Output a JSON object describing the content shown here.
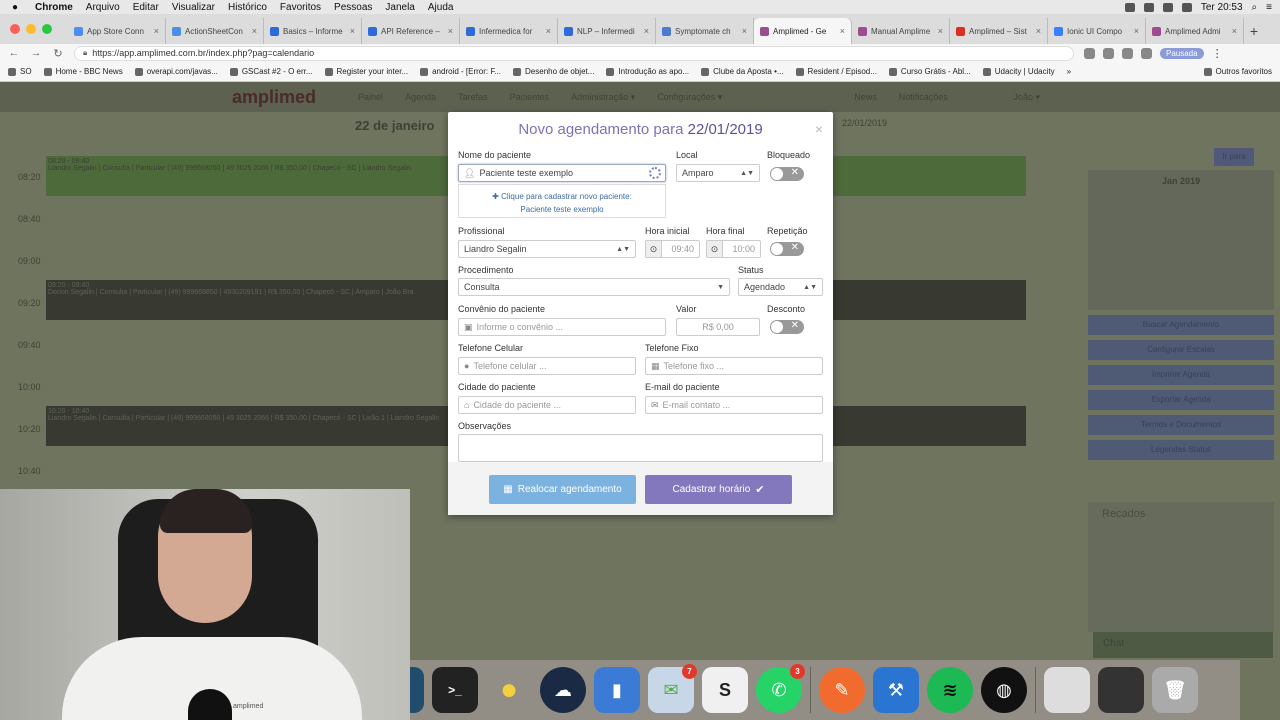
{
  "menubar": {
    "apple": "",
    "items": [
      "Chrome",
      "Arquivo",
      "Editar",
      "Visualizar",
      "Histórico",
      "Favoritos",
      "Pessoas",
      "Janela",
      "Ajuda"
    ],
    "clock": "Ter 20:53"
  },
  "tabs": [
    {
      "title": "App Store Conn",
      "color": "#4c8ef5"
    },
    {
      "title": "ActionSheetCon",
      "color": "#4a90e2"
    },
    {
      "title": "Basics – Informe",
      "color": "#2f6bd8"
    },
    {
      "title": "API Reference –",
      "color": "#2f6bd8"
    },
    {
      "title": "Infermedica for",
      "color": "#2f6bd8"
    },
    {
      "title": "NLP – Infermedi",
      "color": "#2f6bd8"
    },
    {
      "title": "Symptomate ch",
      "color": "#4a7bd0"
    },
    {
      "title": "Amplimed - Ge",
      "color": "#9b4d8f",
      "active": true
    },
    {
      "title": "Manual Amplime",
      "color": "#9b4d8f"
    },
    {
      "title": "Amplimed – Sist",
      "color": "#d93025"
    },
    {
      "title": "Ionic UI Compo",
      "color": "#3880ff"
    },
    {
      "title": "Amplimed Admi",
      "color": "#9b4d8f"
    }
  ],
  "address": {
    "url": "https://app.amplimed.com.br/index.php?pag=calendario",
    "paused_label": "Pausada"
  },
  "bookmarks": {
    "items": [
      "SO",
      "Home - BBC News",
      "overapi.com/javas...",
      "GSCast #2 - O err...",
      "Register your inter...",
      "android - [Error: F...",
      "Desenho de objet...",
      "Introdução as apo...",
      "Clube da Aposta •...",
      "Resident / Episod...",
      "Curso Grátis - Abl...",
      "Udacity | Udacity"
    ],
    "more": "»",
    "other": "Outros favoritos"
  },
  "app": {
    "logo": "amplimed",
    "nav": [
      "Painel",
      "Agenda",
      "Tarefas",
      "Pacientes",
      "Administração ▾",
      "Configurações ▾",
      "News"
    ],
    "notifications": "Notificações",
    "user": "João ▾",
    "date_heading": "22 de janeiro",
    "times": [
      "08:20",
      "08:40",
      "09:00",
      "09:20",
      "09:40",
      "10:00",
      "10:20",
      "10:40"
    ],
    "events": [
      {
        "time": "08:20 - 09:40",
        "text": "Liandro Segalin | Consulta | Particular | (49) 999668050 | 49 3025 2066 | R$ 350,00 | Chapecó - SC | Liandro Segalin"
      },
      {
        "time": "09:20 - 09:40",
        "text": "Dorion Segalin | Consulta | Particular | (49) 999668850 | 4930209191 | R$ 350,00 | Chapecó - SC | Amparo | João Bra"
      },
      {
        "time": "10:20 - 10:40",
        "text": "Liandro Segalin | Consulta | Particular | (49) 999668050 | 49 3025 2066 | R$ 350,00 | Chapecó - SC | Lixão 1 | Liandro Segalin"
      }
    ],
    "date_input": "22/01/2019",
    "search_btn": "Ir para",
    "mini_cal_title": "Jan 2019",
    "side_buttons": [
      "Buscar Agendamento",
      "Configurar Escalas",
      "Imprimir Agenda",
      "Exportar Agenda",
      "Termos e Documentos",
      "Legendas Status"
    ],
    "recados": "Recados",
    "chat": "Chat"
  },
  "modal": {
    "title_prefix": "Novo agendamento para",
    "title_date": "22/01/2019",
    "close": "×",
    "patient_label": "Nome do paciente",
    "patient_value": "Paciente teste exemplo",
    "suggest_line1": "✚ Clique para cadastrar novo paciente:",
    "suggest_line2": "Paciente teste exemplo",
    "local_label": "Local",
    "local_value": "Amparo",
    "blocked_label": "Bloqueado",
    "professional_label": "Profissional",
    "professional_value": "Liandro Segalin",
    "start_label": "Hora inicial",
    "start_value": "09:40",
    "end_label": "Hora final",
    "end_value": "10:00",
    "repeat_label": "Repetição",
    "procedure_label": "Procedimento",
    "procedure_value": "Consulta",
    "status_label": "Status",
    "status_value": "Agendado",
    "insurance_label": "Convênio do paciente",
    "insurance_placeholder": "Informe o convênio ...",
    "value_label": "Valor",
    "value_value": "R$ 0,00",
    "discount_label": "Desconto",
    "cell_label": "Telefone Celular",
    "cell_placeholder": "Telefone celular ...",
    "phone_label": "Telefone Fixo",
    "phone_placeholder": "Telefone fixo ...",
    "city_label": "Cidade do paciente",
    "city_placeholder": "Cidade do paciente ...",
    "email_label": "E-mail do paciente",
    "email_placeholder": "E-mail contato ...",
    "notes_label": "Observações",
    "relocate_btn": "Realocar agendamento",
    "save_btn": "Cadastrar horário"
  },
  "webcam": {
    "shirt_logo": "amplimed"
  },
  "dock": {
    "badges": {
      "mail": "7",
      "whatsapp": "3"
    }
  }
}
